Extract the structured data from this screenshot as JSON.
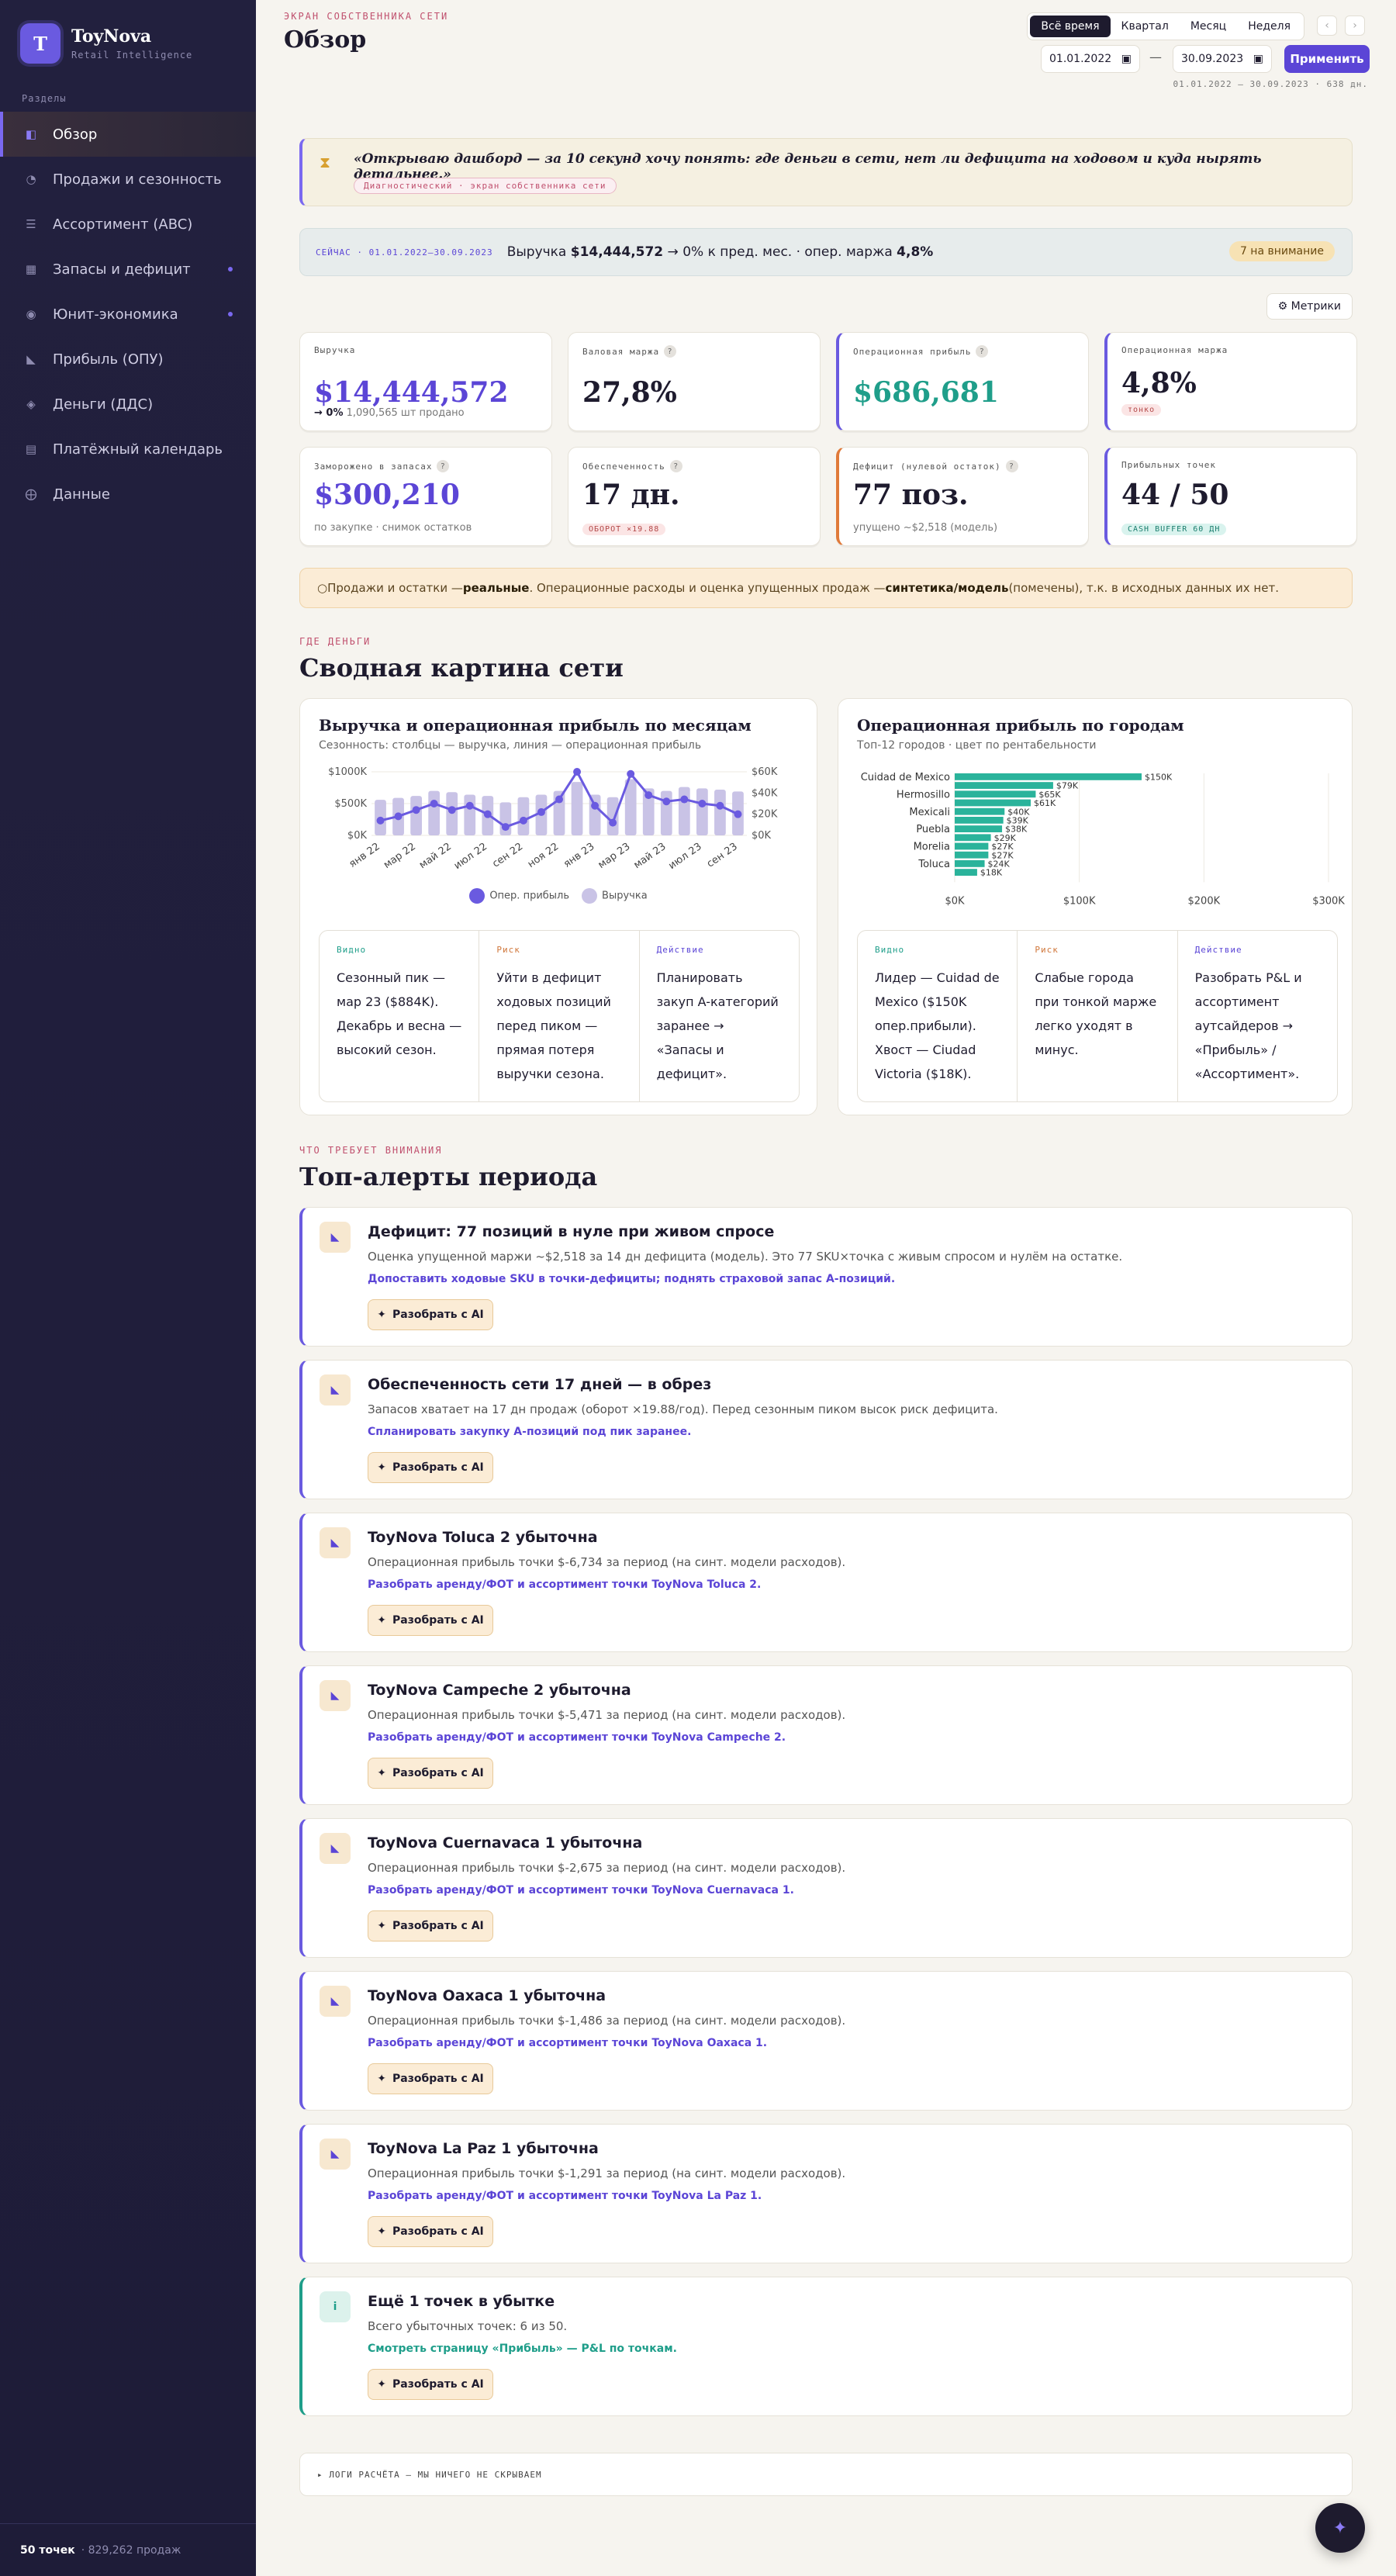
{
  "brand": {
    "logo": "T",
    "name": "ToyNova",
    "sub": "Retail Intelligence"
  },
  "sidebar": {
    "section_label": "Разделы",
    "items": [
      {
        "label": "Обзор",
        "icon": "overview-icon",
        "glyph": "◧"
      },
      {
        "label": "Продажи и сезонность",
        "icon": "pie-icon",
        "glyph": "◔"
      },
      {
        "label": "Ассортимент (ABC)",
        "icon": "list-icon",
        "glyph": "☰"
      },
      {
        "label": "Запасы и дефицит",
        "icon": "box-icon",
        "glyph": "▦"
      },
      {
        "label": "Юнит-экономика",
        "icon": "target-icon",
        "glyph": "◉"
      },
      {
        "label": "Прибыль (ОПУ)",
        "icon": "trend-icon",
        "glyph": "◣"
      },
      {
        "label": "Деньги (ДДС)",
        "icon": "diamond-icon",
        "glyph": "◈"
      },
      {
        "label": "Платёжный календарь",
        "icon": "calendar-icon",
        "glyph": "▤"
      },
      {
        "label": "Данные",
        "icon": "database-icon",
        "glyph": "⨁"
      }
    ],
    "footer_count": "50 точек",
    "footer_sales": "· 829,262 продаж"
  },
  "header": {
    "screen_label": "ЭКРАН СОБСТВЕННИКА СЕТИ",
    "title": "Обзор",
    "periods": [
      "Всё время",
      "Квартал",
      "Месяц",
      "Неделя"
    ],
    "prev": "‹",
    "next": "›",
    "date_from": "01.01.2022",
    "date_to": "30.09.2023",
    "dash": "—",
    "apply": "Применить",
    "range_note": "01.01.2022 — 30.09.2023 · 638 дн."
  },
  "quote": {
    "text": "«Открываю дашборд — за 10 секунд хочу понять: где деньги в сети, нет ли дефицита на ходовом и куда нырять детальнее.»",
    "tag": "Диагностический · экран собственника сети"
  },
  "now": {
    "label": "СЕЙЧАС · 01.01.2022—30.09.2023",
    "prefix": "Выручка ",
    "revenue": "$14,444,572",
    "middle": " → 0% к пред. мес. · опер. маржа ",
    "margin": "4,8%",
    "badge": "7 на внимание"
  },
  "metrics_btn": "⚙ Метрики",
  "kpis": [
    {
      "label": "Выручка",
      "value": "$14,444,572",
      "sub_bold": "→ 0%",
      "sub": " 1,090,565 шт продано"
    },
    {
      "label": "Валовая маржа",
      "value": "27,8%"
    },
    {
      "label": "Операционная прибыль",
      "value": "$686,681"
    },
    {
      "label": "Операционная маржа",
      "value": "4,8%",
      "chip": "тонко"
    },
    {
      "label": "Заморожено в запасах",
      "value": "$300,210",
      "sub": "по закупке · снимок остатков"
    },
    {
      "label": "Обеспеченность",
      "value": "17 дн.",
      "chip": "ОБОРОТ ×19.88"
    },
    {
      "label": "Дефицит (нулевой остаток)",
      "value": "77 поз.",
      "sub": "упущено ~$2,518 (модель)"
    },
    {
      "label": "Прибыльных точек",
      "value": "44 / 50",
      "chip": "CASH BUFFER 60 ДН"
    }
  ],
  "help": "?",
  "note": {
    "icon": "○",
    "p1": " Продажи и остатки — ",
    "b1": "реальные",
    "p2": ". Операционные расходы и оценка упущенных продаж — ",
    "b2": "синтетика/модель",
    "p3": " (помечены), т.к. в исходных данных их нет."
  },
  "section1": {
    "label": "ГДЕ ДЕНЬГИ",
    "title": "Сводная картина сети"
  },
  "chart_data": [
    {
      "type": "bar",
      "title": "Выручка и операционная прибыль по месяцам",
      "subtitle": "Сезонность: столбцы — выручка, линия — операционная прибыль",
      "categories": [
        "янв 22",
        "фев 22",
        "мар 22",
        "апр 22",
        "май 22",
        "июн 22",
        "июл 22",
        "авг 22",
        "сен 22",
        "окт 22",
        "ноя 22",
        "дек 22",
        "янв 23",
        "фев 23",
        "мар 23",
        "апр 23",
        "май 23",
        "июн 23",
        "июл 23",
        "авг 23",
        "сен 23"
      ],
      "tick_labels": [
        "янв 22",
        "мар 22",
        "май 22",
        "июл 22",
        "сен 22",
        "ноя 22",
        "янв 23",
        "мар 23",
        "май 23",
        "июл 23",
        "сен 23"
      ],
      "series": [
        {
          "name": "Выручка",
          "axis": "left",
          "values": [
            560000,
            590000,
            620000,
            700000,
            680000,
            640000,
            620000,
            520000,
            600000,
            640000,
            700000,
            840000,
            640000,
            600000,
            884000,
            740000,
            700000,
            760000,
            740000,
            720000,
            690000
          ]
        },
        {
          "name": "Опер. прибыль",
          "axis": "right",
          "values": [
            14000,
            18000,
            24000,
            30000,
            24000,
            28000,
            20000,
            8000,
            14000,
            22000,
            34000,
            60000,
            28000,
            12000,
            58000,
            38000,
            32000,
            34000,
            30000,
            28000,
            20000
          ]
        }
      ],
      "ylim_left": [
        0,
        1000000
      ],
      "left_ticks": [
        "$0K",
        "$500K",
        "$1000K"
      ],
      "ylim_right": [
        0,
        60000
      ],
      "right_ticks": [
        "$0K",
        "$20K",
        "$40K",
        "$60K"
      ],
      "colors": {
        "bars": "#c9c3e6",
        "line": "#6a5ae0"
      },
      "legend": "bottom"
    },
    {
      "type": "bar",
      "orientation": "horizontal",
      "title": "Операционная прибыль по городам",
      "subtitle": "Топ-12 городов · цвет по рентабельности",
      "categories": [
        "Cuidad de Mexico",
        "",
        "Hermosillo",
        "",
        "Mexicali",
        "",
        "Puebla",
        "",
        "Morelia",
        "",
        "Toluca",
        ""
      ],
      "values": [
        150000,
        79000,
        65000,
        61000,
        40000,
        39000,
        38000,
        29000,
        27000,
        27000,
        24000,
        18000
      ],
      "data_labels": [
        "$150K",
        "$79K",
        "$65K",
        "$61K",
        "$40K",
        "$39K",
        "$38K",
        "$29K",
        "$27K",
        "$27K",
        "$24K",
        "$18K"
      ],
      "xlim": [
        0,
        300000
      ],
      "x_ticks": [
        "$0K",
        "$100K",
        "$200K",
        "$300K"
      ],
      "colors": {
        "bars": "#2ab39b"
      }
    }
  ],
  "card1": {
    "legend_line": "Опер. прибыль",
    "legend_bar": "Выручка",
    "trio": [
      {
        "h": "Видно",
        "b": "Сезонный пик — мар 23 ($884K). Декабрь и весна — высокий сезон."
      },
      {
        "h": "Риск",
        "b": "Уйти в дефицит ходовых позиций перед пиком — прямая потеря выручки сезона."
      },
      {
        "h": "Действие",
        "b": "Планировать закуп A-категорий заранее → «Запасы и дефицит»."
      }
    ]
  },
  "card2": {
    "trio": [
      {
        "h": "Видно",
        "b": "Лидер — Cuidad de Mexico ($150K опер.прибыли). Хвост — Ciudad Victoria ($18K)."
      },
      {
        "h": "Риск",
        "b": "Слабые города при тонкой марже легко уходят в минус."
      },
      {
        "h": "Действие",
        "b": "Разобрать P&L и ассортимент аутсайдеров → «Прибыль» / «Ассортимент»."
      }
    ]
  },
  "section2": {
    "label": "ЧТО ТРЕБУЕТ ВНИМАНИЯ",
    "title": "Топ-алерты периода"
  },
  "alerts": [
    {
      "title": "Дефицит: 77 позиций в нуле при живом спросе",
      "body": "Оценка упущенной маржи ~$2,518 за 14 дн дефицита (модель). Это 77 SKU×точка с живым спросом и нулём на остатке.",
      "action": "Допоставить ходовые SKU в точки-дефициты; поднять страховой запас A-позиций.",
      "icon": "◣"
    },
    {
      "title": "Обеспеченность сети 17 дней — в обрез",
      "body": "Запасов хватает на 17 дн продаж (оборот ×19.88/год). Перед сезонным пиком высок риск дефицита.",
      "action": "Спланировать закупку A-позиций под пик заранее.",
      "icon": "◣"
    },
    {
      "title": "ToyNova Toluca 2 убыточна",
      "body": "Операционная прибыль точки $-6,734 за период (на синт. модели расходов).",
      "action": "Разобрать аренду/ФОТ и ассортимент точки ToyNova Toluca 2.",
      "icon": "◣"
    },
    {
      "title": "ToyNova Campeche 2 убыточна",
      "body": "Операционная прибыль точки $-5,471 за период (на синт. модели расходов).",
      "action": "Разобрать аренду/ФОТ и ассортимент точки ToyNova Campeche 2.",
      "icon": "◣"
    },
    {
      "title": "ToyNova Cuernavaca 1 убыточна",
      "body": "Операционная прибыль точки $-2,675 за период (на синт. модели расходов).",
      "action": "Разобрать аренду/ФОТ и ассортимент точки ToyNova Cuernavaca 1.",
      "icon": "◣"
    },
    {
      "title": "ToyNova Oaxaca 1 убыточна",
      "body": "Операционная прибыль точки $-1,486 за период (на синт. модели расходов).",
      "action": "Разобрать аренду/ФОТ и ассортимент точки ToyNova Oaxaca 1.",
      "icon": "◣"
    },
    {
      "title": "ToyNova La Paz 1 убыточна",
      "body": "Операционная прибыль точки $-1,291 за период (на синт. модели расходов).",
      "action": "Разобрать аренду/ФОТ и ассортимент точки ToyNova La Paz 1.",
      "icon": "◣"
    },
    {
      "title": "Ещё 1 точек в убытке",
      "body": "Всего убыточных точек: 6 из 50.",
      "action": "Смотреть страницу «Прибыль» — P&L по точкам.",
      "icon": "i"
    }
  ],
  "ai_button": "Разобрать с AI",
  "ai_glyph": "✦",
  "logs": "▸ ЛОГИ РАСЧЁТА — МЫ НИЧЕГО НЕ СКРЫВАЕМ",
  "fab": "✦"
}
